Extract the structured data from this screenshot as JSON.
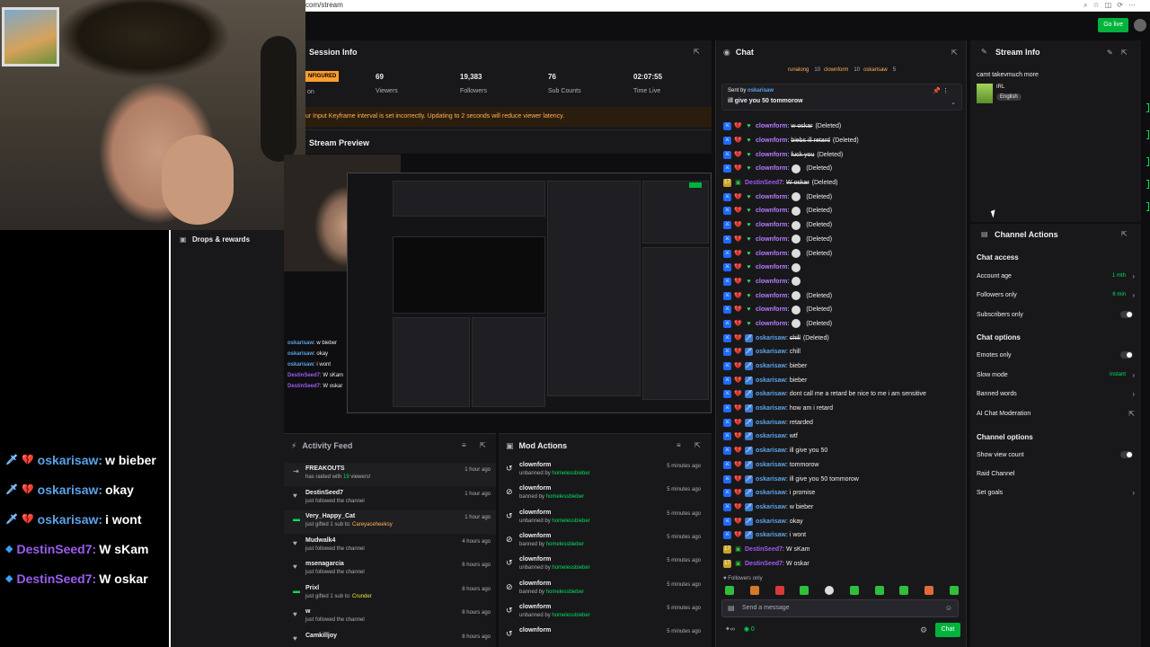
{
  "browser": {
    "url": "com/stream"
  },
  "header": {
    "go_live": "Go live"
  },
  "left": {
    "drops": "Drops & rewards"
  },
  "overlay_chat": [
    {
      "user": "oskarisaw",
      "msg": "w bieber",
      "badge": "💔",
      "type": "osk"
    },
    {
      "user": "oskarisaw",
      "msg": "okay",
      "badge": "💔",
      "type": "osk"
    },
    {
      "user": "oskarisaw",
      "msg": "i wont",
      "badge": "💔",
      "type": "osk"
    },
    {
      "user": "DestinSeed7",
      "msg": "W sKam",
      "badge": "",
      "type": "des"
    },
    {
      "user": "DestinSeed7",
      "msg": "W oskar",
      "badge": "",
      "type": "des"
    }
  ],
  "session": {
    "title": "Session Info",
    "badge": "NFIGURED",
    "on_label": "on",
    "stats": [
      {
        "value": "69",
        "label": "Viewers"
      },
      {
        "value": "19,383",
        "label": "Followers"
      },
      {
        "value": "76",
        "label": "Sub Counts"
      },
      {
        "value": "02:07:55",
        "label": "Time Live"
      }
    ],
    "warning": "ur Input Keyframe interval is set incorrectly. Updating to 2 seconds will reduce viewer latency."
  },
  "preview": {
    "title": "Stream Preview",
    "chat": [
      {
        "user": "oskarisaw",
        "msg": "w bieber",
        "type": "osk"
      },
      {
        "user": "oskarisaw",
        "msg": "okay",
        "type": "osk"
      },
      {
        "user": "oskarisaw",
        "msg": "i wont",
        "type": "osk"
      },
      {
        "user": "DestinSeed7",
        "msg": "W sKam",
        "type": "des"
      },
      {
        "user": "DestinSeed7",
        "msg": "W oskar",
        "type": "des"
      }
    ]
  },
  "activity": {
    "title": "Activity Feed",
    "items": [
      {
        "icon": "⇥",
        "name": "FREAKOUTS",
        "sub": "has raided with ",
        "num": "19",
        "sub2": " viewers!",
        "time": "1 hour ago"
      },
      {
        "icon": "♥",
        "name": "DestinSeed7",
        "sub": "just followed the channel",
        "time": "1 hour ago"
      },
      {
        "icon": "▬",
        "name": "Very_Happy_Cat",
        "sub": "just gifted 1 sub to: ",
        "hl": "Careyaceheeksy",
        "time": "1 hour ago"
      },
      {
        "icon": "♥",
        "name": "Mudwalk4",
        "sub": "just followed the channel",
        "time": "4 hours ago"
      },
      {
        "icon": "♥",
        "name": "msenagarcia",
        "sub": "just followed the channel",
        "time": "6 hours ago"
      },
      {
        "icon": "▬",
        "name": "Prixl",
        "sub": "just gifted 1 sub to: ",
        "hl2": "Crunder",
        "time": "8 hours ago"
      },
      {
        "icon": "♥",
        "name": "w",
        "sub": "just followed the channel",
        "time": "8 hours ago"
      },
      {
        "icon": "♥",
        "name": "Camkilljoy",
        "sub": "",
        "time": "8 hours ago"
      }
    ]
  },
  "mod_actions": {
    "title": "Mod Actions",
    "items": [
      {
        "icon": "↺",
        "name": "clownform",
        "action": "unbanned by ",
        "by": "homelessbieber",
        "time": "5 minutes ago"
      },
      {
        "icon": "⊘",
        "name": "clownform",
        "action": "banned by ",
        "by": "homelessbieber",
        "time": "5 minutes ago"
      },
      {
        "icon": "↺",
        "name": "clownform",
        "action": "unbanned by ",
        "by": "homelessbieber",
        "time": "5 minutes ago"
      },
      {
        "icon": "⊘",
        "name": "clownform",
        "action": "banned by ",
        "by": "homelessbieber",
        "time": "5 minutes ago"
      },
      {
        "icon": "↺",
        "name": "clownform",
        "action": "unbanned by ",
        "by": "homelessbieber",
        "time": "5 minutes ago"
      },
      {
        "icon": "⊘",
        "name": "clownform",
        "action": "banned by ",
        "by": "homelessbieber",
        "time": "5 minutes ago"
      },
      {
        "icon": "↺",
        "name": "clownform",
        "action": "unbanned by ",
        "by": "homelessbieber",
        "time": "5 minutes ago"
      },
      {
        "icon": "↺",
        "name": "clownform",
        "action": "",
        "by": "",
        "time": "5 minutes ago"
      }
    ]
  },
  "chat": {
    "title": "Chat",
    "top_viewers": [
      {
        "name": "runalong",
        "count": "10"
      },
      {
        "name": "clownform",
        "count": "10"
      },
      {
        "name": "oskarisaw",
        "count": "5"
      }
    ],
    "pinned": {
      "sent_by": "Sent by",
      "user": "oskarisaw",
      "msg": "ill give you 50 tommorow"
    },
    "messages": [
      {
        "user": "clownform",
        "text": "w oskar",
        "deleted": true,
        "emote": false,
        "ut": "c"
      },
      {
        "user": "clownform",
        "text": "biebs ill retard",
        "deleted": true,
        "emote": false,
        "ut": "c"
      },
      {
        "user": "clownform",
        "text": "fuck you",
        "deleted": true,
        "emote": false,
        "ut": "c"
      },
      {
        "user": "clownform",
        "text": "",
        "deleted": true,
        "emote": true,
        "ut": "c"
      },
      {
        "user": "DestinSeed7",
        "text": "W oskar",
        "deleted": true,
        "emote": false,
        "ut": "d"
      },
      {
        "user": "clownform",
        "text": "",
        "deleted": true,
        "emote": true,
        "ut": "c"
      },
      {
        "user": "clownform",
        "text": "",
        "deleted": true,
        "emote": true,
        "ut": "c"
      },
      {
        "user": "clownform",
        "text": "",
        "deleted": true,
        "emote": true,
        "ut": "c"
      },
      {
        "user": "clownform",
        "text": "",
        "deleted": true,
        "emote": true,
        "ut": "c"
      },
      {
        "user": "clownform",
        "text": "",
        "deleted": true,
        "emote": true,
        "ut": "c"
      },
      {
        "user": "clownform",
        "text": "",
        "deleted": false,
        "emote": true,
        "ut": "c"
      },
      {
        "user": "clownform",
        "text": "",
        "deleted": false,
        "emote": true,
        "ut": "c"
      },
      {
        "user": "clownform",
        "text": "",
        "deleted": true,
        "emote": true,
        "ut": "c"
      },
      {
        "user": "clownform",
        "text": "",
        "deleted": true,
        "emote": true,
        "ut": "c"
      },
      {
        "user": "clownform",
        "text": "",
        "deleted": true,
        "emote": true,
        "ut": "c"
      },
      {
        "user": "oskarisaw",
        "text": "chill",
        "deleted": true,
        "emote": false,
        "ut": "o"
      },
      {
        "user": "oskarisaw",
        "text": "chill",
        "deleted": false,
        "emote": false,
        "ut": "o"
      },
      {
        "user": "oskarisaw",
        "text": "bieber",
        "deleted": false,
        "emote": false,
        "ut": "o"
      },
      {
        "user": "oskarisaw",
        "text": "bieber",
        "deleted": false,
        "emote": false,
        "ut": "o"
      },
      {
        "user": "oskarisaw",
        "text": "dont call me a retard be nice to me i am sensitive",
        "deleted": false,
        "emote": false,
        "ut": "o"
      },
      {
        "user": "oskarisaw",
        "text": "how am i retard",
        "deleted": false,
        "emote": false,
        "ut": "o"
      },
      {
        "user": "oskarisaw",
        "text": "retarded",
        "deleted": false,
        "emote": false,
        "ut": "o"
      },
      {
        "user": "oskarisaw",
        "text": "wtf",
        "deleted": false,
        "emote": false,
        "ut": "o"
      },
      {
        "user": "oskarisaw",
        "text": "ill give you 50",
        "deleted": false,
        "emote": false,
        "ut": "o"
      },
      {
        "user": "oskarisaw",
        "text": "tommorow",
        "deleted": false,
        "emote": false,
        "ut": "o"
      },
      {
        "user": "oskarisaw",
        "text": "ill give you 50 tommorow",
        "deleted": false,
        "emote": false,
        "ut": "o"
      },
      {
        "user": "oskarisaw",
        "text": "i promise",
        "deleted": false,
        "emote": false,
        "ut": "o"
      },
      {
        "user": "oskarisaw",
        "text": "w bieber",
        "deleted": false,
        "emote": false,
        "ut": "o"
      },
      {
        "user": "oskarisaw",
        "text": "okay",
        "deleted": false,
        "emote": false,
        "ut": "o"
      },
      {
        "user": "oskarisaw",
        "text": "i wont",
        "deleted": false,
        "emote": false,
        "ut": "o"
      },
      {
        "user": "DestinSeed7",
        "text": "W sKam",
        "deleted": false,
        "emote": false,
        "ut": "d"
      },
      {
        "user": "DestinSeed7",
        "text": "W oskar",
        "deleted": false,
        "emote": false,
        "ut": "d"
      }
    ],
    "deleted_label": "(Deleted)",
    "followers_only": "Followers only",
    "placeholder": "Send a message",
    "bits": "0",
    "points": "0",
    "chat_button": "Chat"
  },
  "stream_info": {
    "title": "Stream Info",
    "stream_title": "camt takevmuch more",
    "category": "IRL",
    "language": "English"
  },
  "channel_actions": {
    "title": "Channel Actions",
    "sections": {
      "access": "Chat access",
      "options": "Chat options",
      "channel": "Channel options"
    },
    "account_age": {
      "label": "Account age",
      "value": "1 mth"
    },
    "followers_only": {
      "label": "Followers only",
      "value": "6 min"
    },
    "subscribers_only": "Subscribers only",
    "emotes_only": "Emotes only",
    "slow_mode": {
      "label": "Slow mode",
      "value": "Instant"
    },
    "banned_words": "Banned words",
    "ai_moderation": "AI Chat Moderation",
    "show_view_count": "Show view count",
    "raid_channel": "Raid Channel",
    "set_goals": "Set goals"
  },
  "colors": {
    "bg": "#0e0e10",
    "panel": "#18181b",
    "green": "#00e05a",
    "oskar_blue": "#5aa3e8",
    "destin_purple": "#9b5cf0",
    "clown_purple": "#b57bff",
    "warn_orange": "#ffb25a"
  }
}
